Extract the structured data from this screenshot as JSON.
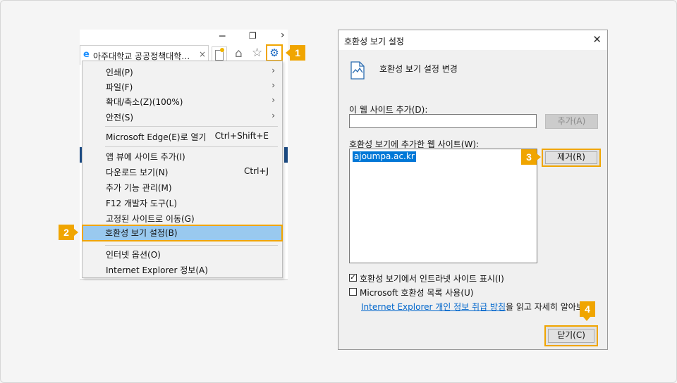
{
  "colors": {
    "accent": "#f0a500",
    "menu_highlight": "#99c9ef",
    "list_selection": "#0078d7",
    "link": "#0066cc"
  },
  "ie": {
    "tab_title": "아주대학교 공공정책대학…",
    "tab_close": "×",
    "window_controls": {
      "minimize": "─",
      "restore": "❐",
      "chevron": "›"
    },
    "icons": {
      "browser": "e-icon",
      "new_tab": "new-tab-icon",
      "home": "home-icon",
      "favorites": "star-icon",
      "tools": "gear-icon"
    },
    "home_glyph": "⌂",
    "star_glyph": "☆",
    "gear_glyph": "⚙"
  },
  "menu": {
    "items": [
      {
        "label": "인쇄(P)",
        "arrow": "›"
      },
      {
        "label": "파일(F)",
        "arrow": "›"
      },
      {
        "label": "확대/축소(Z)(100%)",
        "arrow": "›"
      },
      {
        "label": "안전(S)",
        "arrow": "›"
      },
      {
        "label": "Microsoft Edge(E)로 열기",
        "shortcut": "Ctrl+Shift+E"
      },
      {
        "label": "앱 뷰에 사이트 추가(I)"
      },
      {
        "label": "다운로드 보기(N)",
        "shortcut": "Ctrl+J"
      },
      {
        "label": "추가 기능 관리(M)"
      },
      {
        "label": "F12 개발자 도구(L)"
      },
      {
        "label": "고정된 사이트로 이동(G)"
      },
      {
        "label": "호환성 보기 설정(B)",
        "selected": true
      },
      {
        "label": "인터넷 옵션(O)"
      },
      {
        "label": "Internet Explorer 정보(A)"
      }
    ]
  },
  "badges": [
    "1",
    "2",
    "3",
    "4"
  ],
  "dialog": {
    "title": "호환성 보기 설정",
    "close_glyph": "✕",
    "heading": "호환성 보기 설정 변경",
    "add_label": "이 웹 사이트 추가(D):",
    "add_input_value": "",
    "add_button": "추가(A)",
    "list_label": "호환성 보기에 추가한 웹 사이트(W):",
    "list_items": [
      "ajoumpa.ac.kr"
    ],
    "remove_button": "제거(R)",
    "checkbox_intranet": {
      "label": "호환성 보기에서 인트라넷 사이트 표시(I)",
      "checked": true,
      "mark": "✓"
    },
    "checkbox_ms_list": {
      "label": "Microsoft 호환성 목록 사용(U)",
      "checked": false
    },
    "link_text": "Internet Explorer 개인 정보 취급 방침",
    "link_suffix": "을 읽고 자세히 알아보기",
    "close_button": "닫기(C)"
  }
}
